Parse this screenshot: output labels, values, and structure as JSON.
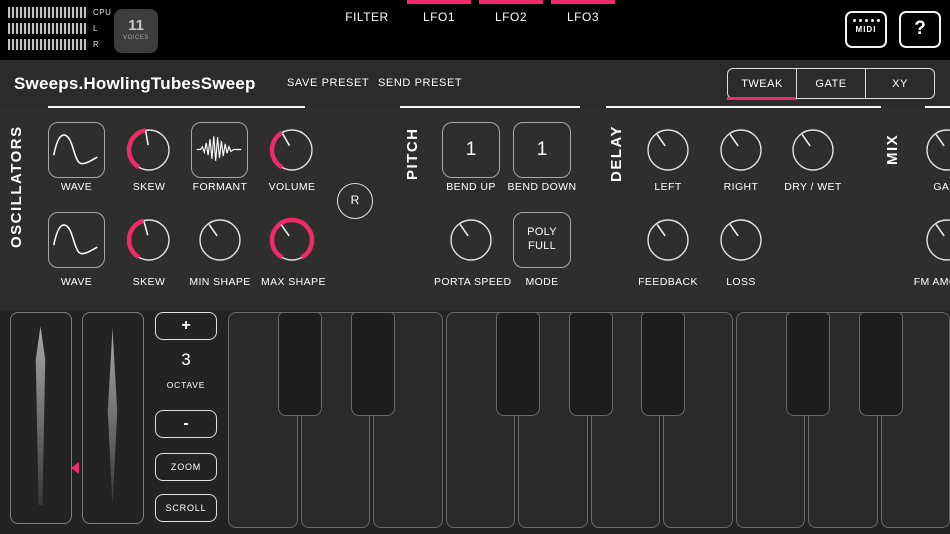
{
  "colors": {
    "accent": "#f02a6a"
  },
  "topbar": {
    "meters": {
      "cpu": "CPU",
      "l": "L",
      "r": "R"
    },
    "voices": {
      "count": "11",
      "label": "VOICES"
    },
    "tabs": {
      "filter": "FILTER",
      "lfo1": "LFO1",
      "lfo2": "LFO2",
      "lfo3": "LFO3"
    },
    "midi": "MIDI",
    "help": "?"
  },
  "presetbar": {
    "title": "Sweeps.HowlingTubesSweep",
    "save": "SAVE PRESET",
    "send": "SEND PRESET",
    "modes": {
      "tweak": "TWEAK",
      "gate": "GATE",
      "xy": "XY"
    }
  },
  "osc": {
    "title": "OSCILLATORS",
    "wave1": "WAVE",
    "skew1": "SKEW",
    "formant": "FORMANT",
    "volume": "VOLUME",
    "randomize": "R",
    "wave2": "WAVE",
    "skew2": "SKEW",
    "min_shape": "MIN SHAPE",
    "max_shape": "MAX SHAPE"
  },
  "pitch": {
    "title": "PITCH",
    "bend_up_value": "1",
    "bend_down_value": "1",
    "bend_up": "BEND UP",
    "bend_down": "BEND DOWN",
    "porta_speed": "PORTA SPEED",
    "mode_value": "POLY FULL",
    "mode": "MODE"
  },
  "delay": {
    "title": "DELAY",
    "left": "LEFT",
    "right": "RIGHT",
    "dry_wet": "DRY / WET",
    "feedback": "FEEDBACK",
    "loss": "LOSS"
  },
  "mix": {
    "title": "MIX",
    "gain": "GAIN",
    "fm_amount": "FM AMOUNT"
  },
  "kbd": {
    "plus": "+",
    "minus": "-",
    "octave_value": "3",
    "octave_label": "OCTAVE",
    "zoom": "ZOOM",
    "scroll": "SCROLL"
  }
}
